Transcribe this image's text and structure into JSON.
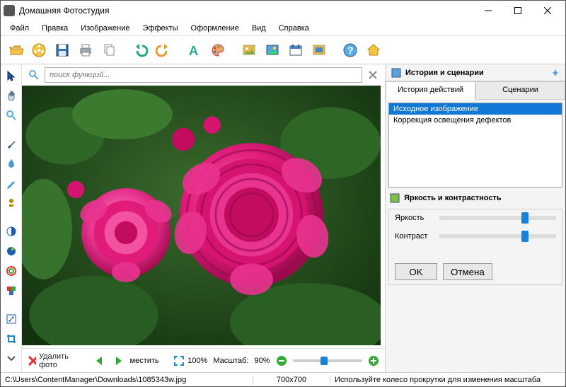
{
  "title": "Домашняя Фотостудия",
  "menu": [
    "Файл",
    "Правка",
    "Изображение",
    "Эффекты",
    "Оформление",
    "Вид",
    "Справка"
  ],
  "search": {
    "placeholder": "поиск функций..."
  },
  "bottom": {
    "delete": "Удалить фото",
    "move": "местить",
    "fit": "100%",
    "zoom_label": "Масштаб:",
    "zoom_value": "90%"
  },
  "right": {
    "history_panel": "История и сценарии",
    "tab_history": "История действий",
    "tab_scenarios": "Сценарии",
    "history": [
      "Исходное изображение",
      "Коррекция освещения дефектов"
    ],
    "bc_panel": "Яркость и контрастность",
    "brightness": "Яркость",
    "contrast": "Контраст",
    "ok": "OK",
    "cancel": "Отмена"
  },
  "status": {
    "path": "C:\\Users\\ContentManager\\Downloads\\1085343w.jpg",
    "dims": "700x700",
    "hint": "Используйте колесо прокрутки для изменения масштаба"
  }
}
